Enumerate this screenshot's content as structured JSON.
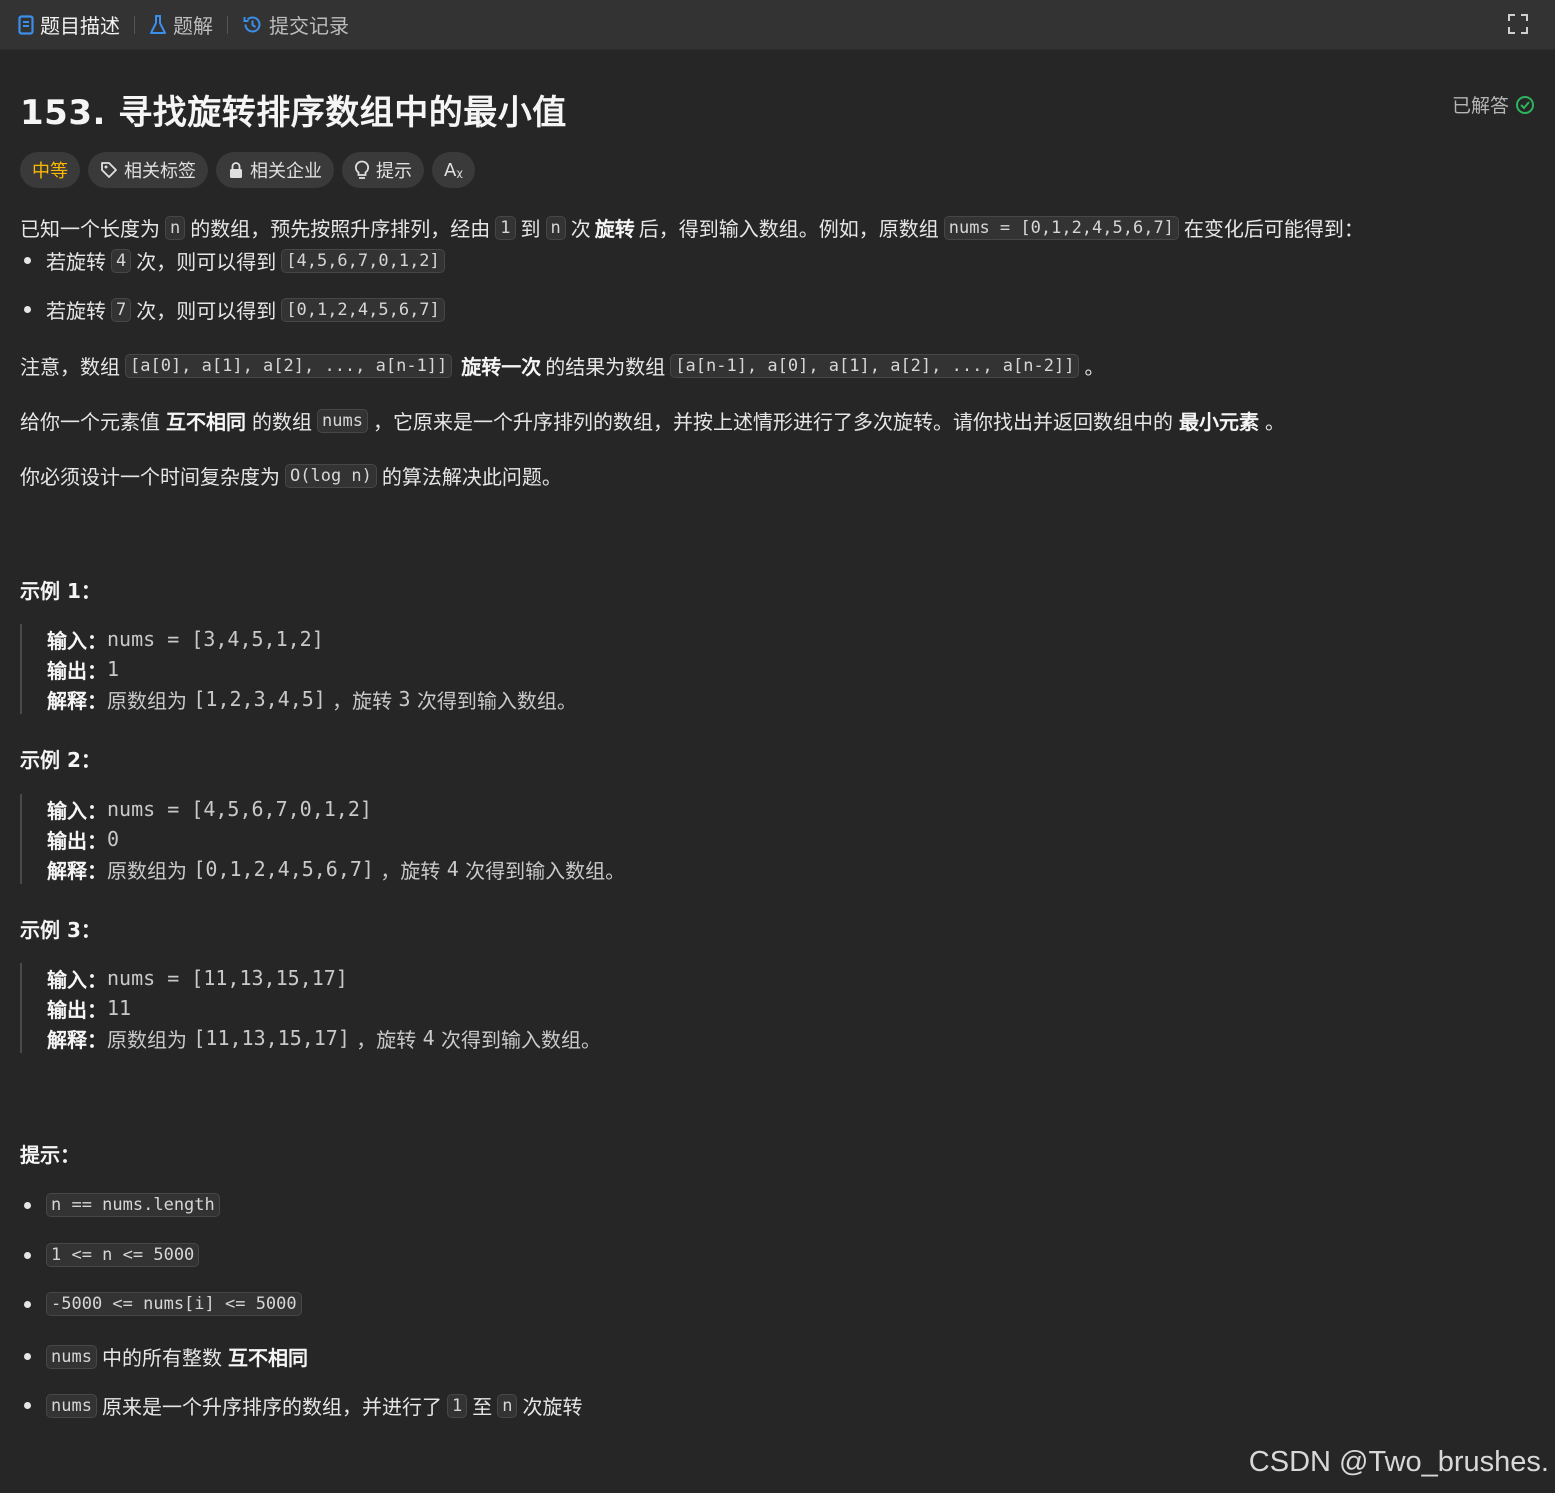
{
  "tabs": {
    "description": "题目描述",
    "solutions": "题解",
    "submissions": "提交记录"
  },
  "problem": {
    "title": "153. 寻找旋转排序数组中的最小值",
    "status": "已解答",
    "difficulty": "中等",
    "tags": [
      "相关标签",
      "相关企业",
      "提示",
      "Aᵪ"
    ]
  },
  "desc": {
    "p1": [
      "已知一个长度为",
      "n",
      "的数组，预先按照升序排列，经由",
      "1",
      "到",
      "n",
      "次",
      "旋转",
      "后，得到输入数组。例如，原数组",
      "nums = [0,1,2,4,5,6,7]",
      "在变化后可能得到："
    ],
    "b1": [
      "若旋转",
      "4",
      "次，则可以得到",
      "[4,5,6,7,0,1,2]"
    ],
    "b2": [
      "若旋转",
      "7",
      "次，则可以得到",
      "[0,1,2,4,5,6,7]"
    ],
    "p2": [
      "注意，数组",
      "[a[0], a[1], a[2], ..., a[n-1]]",
      "旋转一次",
      "的结果为数组",
      "[a[n-1], a[0], a[1], a[2], ..., a[n-2]]",
      "。"
    ],
    "p3": [
      "给你一个元素值",
      "互不相同",
      "的数组",
      "nums",
      "，它原来是一个升序排列的数组，并按上述情形进行了多次旋转。请你找出并返回数组中的",
      "最小元素",
      "。"
    ],
    "p4": [
      "你必须设计一个时间复杂度为",
      "O(log n)",
      "的算法解决此问题。"
    ]
  },
  "labels": {
    "input": "输入：",
    "output": "输出：",
    "explain": "解释："
  },
  "examples": [
    {
      "heading": "示例 1：",
      "input": "nums = [3,4,5,1,2]",
      "output": "1",
      "explain_a": "原数组为",
      "explain_b": "[1,2,3,4,5]",
      "explain_c": "，旋转",
      "explain_d": "3",
      "explain_e": "次得到输入数组。"
    },
    {
      "heading": "示例 2：",
      "input": "nums = [4,5,6,7,0,1,2]",
      "output": "0",
      "explain_a": "原数组为",
      "explain_b": "[0,1,2,4,5,6,7]",
      "explain_c": "，旋转",
      "explain_d": "4",
      "explain_e": "次得到输入数组。"
    },
    {
      "heading": "示例 3：",
      "input": "nums = [11,13,15,17]",
      "output": "11",
      "explain_a": "原数组为",
      "explain_b": "[11,13,15,17]",
      "explain_c": "，旋转",
      "explain_d": "4",
      "explain_e": "次得到输入数组。"
    }
  ],
  "constraints": {
    "heading": "提示：",
    "c1": "n == nums.length",
    "c2": "1 <= n <= 5000",
    "c3": "-5000 <= nums[i] <= 5000",
    "c4": [
      "nums",
      "中的所有整数",
      "互不相同"
    ],
    "c5": [
      "nums",
      "原来是一个升序排序的数组，并进行了",
      "1",
      "至",
      "n",
      "次旋转"
    ]
  },
  "watermark": "CSDN @Two_brushes.",
  "colors": {
    "background": "#262626",
    "topbar": "#333333",
    "difficulty": "#ffb800",
    "solved": "#2db55d",
    "accent": "#3b8eea"
  }
}
